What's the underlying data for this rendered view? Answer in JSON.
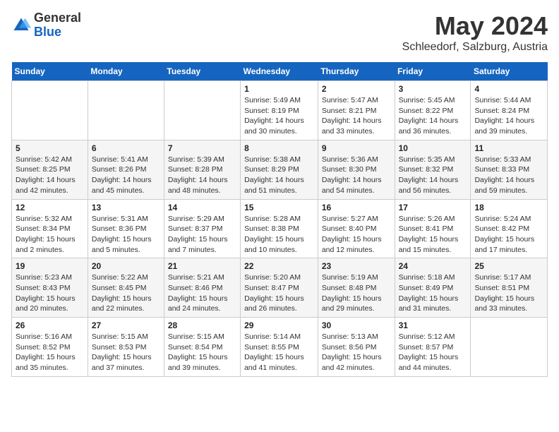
{
  "header": {
    "logo_general": "General",
    "logo_blue": "Blue",
    "title": "May 2024",
    "location": "Schleedorf, Salzburg, Austria"
  },
  "days_of_week": [
    "Sunday",
    "Monday",
    "Tuesday",
    "Wednesday",
    "Thursday",
    "Friday",
    "Saturday"
  ],
  "weeks": [
    [
      {
        "day": "",
        "info": ""
      },
      {
        "day": "",
        "info": ""
      },
      {
        "day": "",
        "info": ""
      },
      {
        "day": "1",
        "info": "Sunrise: 5:49 AM\nSunset: 8:19 PM\nDaylight: 14 hours\nand 30 minutes."
      },
      {
        "day": "2",
        "info": "Sunrise: 5:47 AM\nSunset: 8:21 PM\nDaylight: 14 hours\nand 33 minutes."
      },
      {
        "day": "3",
        "info": "Sunrise: 5:45 AM\nSunset: 8:22 PM\nDaylight: 14 hours\nand 36 minutes."
      },
      {
        "day": "4",
        "info": "Sunrise: 5:44 AM\nSunset: 8:24 PM\nDaylight: 14 hours\nand 39 minutes."
      }
    ],
    [
      {
        "day": "5",
        "info": "Sunrise: 5:42 AM\nSunset: 8:25 PM\nDaylight: 14 hours\nand 42 minutes."
      },
      {
        "day": "6",
        "info": "Sunrise: 5:41 AM\nSunset: 8:26 PM\nDaylight: 14 hours\nand 45 minutes."
      },
      {
        "day": "7",
        "info": "Sunrise: 5:39 AM\nSunset: 8:28 PM\nDaylight: 14 hours\nand 48 minutes."
      },
      {
        "day": "8",
        "info": "Sunrise: 5:38 AM\nSunset: 8:29 PM\nDaylight: 14 hours\nand 51 minutes."
      },
      {
        "day": "9",
        "info": "Sunrise: 5:36 AM\nSunset: 8:30 PM\nDaylight: 14 hours\nand 54 minutes."
      },
      {
        "day": "10",
        "info": "Sunrise: 5:35 AM\nSunset: 8:32 PM\nDaylight: 14 hours\nand 56 minutes."
      },
      {
        "day": "11",
        "info": "Sunrise: 5:33 AM\nSunset: 8:33 PM\nDaylight: 14 hours\nand 59 minutes."
      }
    ],
    [
      {
        "day": "12",
        "info": "Sunrise: 5:32 AM\nSunset: 8:34 PM\nDaylight: 15 hours\nand 2 minutes."
      },
      {
        "day": "13",
        "info": "Sunrise: 5:31 AM\nSunset: 8:36 PM\nDaylight: 15 hours\nand 5 minutes."
      },
      {
        "day": "14",
        "info": "Sunrise: 5:29 AM\nSunset: 8:37 PM\nDaylight: 15 hours\nand 7 minutes."
      },
      {
        "day": "15",
        "info": "Sunrise: 5:28 AM\nSunset: 8:38 PM\nDaylight: 15 hours\nand 10 minutes."
      },
      {
        "day": "16",
        "info": "Sunrise: 5:27 AM\nSunset: 8:40 PM\nDaylight: 15 hours\nand 12 minutes."
      },
      {
        "day": "17",
        "info": "Sunrise: 5:26 AM\nSunset: 8:41 PM\nDaylight: 15 hours\nand 15 minutes."
      },
      {
        "day": "18",
        "info": "Sunrise: 5:24 AM\nSunset: 8:42 PM\nDaylight: 15 hours\nand 17 minutes."
      }
    ],
    [
      {
        "day": "19",
        "info": "Sunrise: 5:23 AM\nSunset: 8:43 PM\nDaylight: 15 hours\nand 20 minutes."
      },
      {
        "day": "20",
        "info": "Sunrise: 5:22 AM\nSunset: 8:45 PM\nDaylight: 15 hours\nand 22 minutes."
      },
      {
        "day": "21",
        "info": "Sunrise: 5:21 AM\nSunset: 8:46 PM\nDaylight: 15 hours\nand 24 minutes."
      },
      {
        "day": "22",
        "info": "Sunrise: 5:20 AM\nSunset: 8:47 PM\nDaylight: 15 hours\nand 26 minutes."
      },
      {
        "day": "23",
        "info": "Sunrise: 5:19 AM\nSunset: 8:48 PM\nDaylight: 15 hours\nand 29 minutes."
      },
      {
        "day": "24",
        "info": "Sunrise: 5:18 AM\nSunset: 8:49 PM\nDaylight: 15 hours\nand 31 minutes."
      },
      {
        "day": "25",
        "info": "Sunrise: 5:17 AM\nSunset: 8:51 PM\nDaylight: 15 hours\nand 33 minutes."
      }
    ],
    [
      {
        "day": "26",
        "info": "Sunrise: 5:16 AM\nSunset: 8:52 PM\nDaylight: 15 hours\nand 35 minutes."
      },
      {
        "day": "27",
        "info": "Sunrise: 5:15 AM\nSunset: 8:53 PM\nDaylight: 15 hours\nand 37 minutes."
      },
      {
        "day": "28",
        "info": "Sunrise: 5:15 AM\nSunset: 8:54 PM\nDaylight: 15 hours\nand 39 minutes."
      },
      {
        "day": "29",
        "info": "Sunrise: 5:14 AM\nSunset: 8:55 PM\nDaylight: 15 hours\nand 41 minutes."
      },
      {
        "day": "30",
        "info": "Sunrise: 5:13 AM\nSunset: 8:56 PM\nDaylight: 15 hours\nand 42 minutes."
      },
      {
        "day": "31",
        "info": "Sunrise: 5:12 AM\nSunset: 8:57 PM\nDaylight: 15 hours\nand 44 minutes."
      },
      {
        "day": "",
        "info": ""
      }
    ]
  ]
}
